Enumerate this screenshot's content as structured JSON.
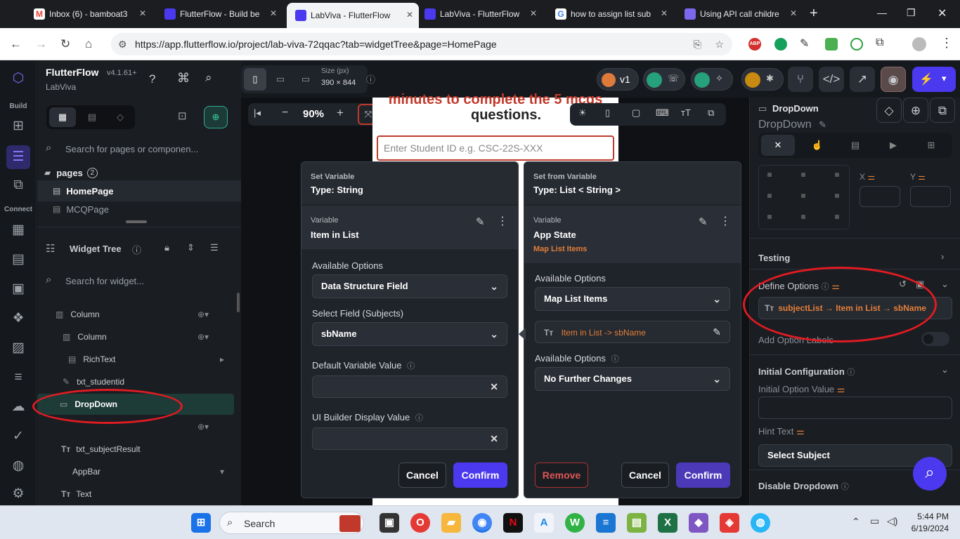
{
  "browser": {
    "tabs": [
      {
        "label": "Inbox (6) - bamboat3",
        "color": "#ea4335"
      },
      {
        "label": "FlutterFlow - Build be",
        "color": "#4b39ef"
      },
      {
        "label": "LabViva - FlutterFlow",
        "color": "#4b39ef"
      },
      {
        "label": "LabViva - FlutterFlow",
        "color": "#4b39ef"
      },
      {
        "label": "how to assign list sub",
        "color": "#4285f4"
      },
      {
        "label": "Using API call childre",
        "color": "#7b68ee"
      }
    ],
    "url": "https://app.flutterflow.io/project/lab-viva-72qqac?tab=widgetTree&page=HomePage"
  },
  "sidebar": {
    "brand": "FlutterFlow",
    "version": "v4.1.61+",
    "project": "LabViva",
    "build_label": "Build",
    "connect_label": "Connect",
    "search_pages_placeholder": "Search for pages or componen...",
    "pages_label": "pages",
    "pages_count": "2",
    "pages": [
      "HomePage",
      "MCQPage"
    ],
    "widget_tree_label": "Widget Tree",
    "search_widget_placeholder": "Search for widget...",
    "tree": [
      "Column",
      "Column",
      "RichText",
      "txt_studentid",
      "DropDown",
      "txt_subjectResult",
      "AppBar",
      "Text"
    ]
  },
  "toolbar": {
    "size_label": "Size (px)",
    "size_value": "390 × 844",
    "zoom": "90%",
    "version": "v1"
  },
  "canvas": {
    "preview_line1": "minutes to complete the 5 mcqs",
    "preview_line2": "questions.",
    "input_placeholder": "Enter Student ID e.g. CSC-22S-XXX"
  },
  "left_dialog": {
    "header_small": "Set Variable",
    "header_type": "Type: String",
    "var_small": "Variable",
    "var_name": "Item in List",
    "available_options_label": "Available Options",
    "available_options_value": "Data Structure Field",
    "select_field_label": "Select Field (Subjects)",
    "select_field_value": "sbName",
    "default_value_label": "Default Variable Value",
    "ui_builder_label": "UI Builder Display Value",
    "cancel": "Cancel",
    "confirm": "Confirm"
  },
  "right_dialog": {
    "header_small": "Set from Variable",
    "header_type": "Type: List < String >",
    "var_small": "Variable",
    "var_name": "App State",
    "var_sub": "Map List Items",
    "available_options_label": "Available Options",
    "available_options_value": "Map List Items",
    "chip_text": "Item in List -> sbName",
    "available_options2_label": "Available Options",
    "available_options2_value": "No Further Changes",
    "remove": "Remove",
    "cancel": "Cancel",
    "confirm": "Confirm"
  },
  "properties": {
    "widget_type": "DropDown",
    "widget_name": "DropDown",
    "x_label": "X",
    "y_label": "Y",
    "testing": "Testing",
    "define_options": "Define Options",
    "define_options_value": "subjectList → Item in List → sbName",
    "add_option_labels": "Add Option Labels",
    "initial_config": "Initial Configuration",
    "initial_option_value": "Initial Option Value",
    "hint_text": "Hint Text",
    "hint_value": "Select Subject",
    "disable_dropdown": "Disable Dropdown"
  },
  "taskbar": {
    "search": "Search",
    "time": "5:44 PM",
    "date": "6/19/2024"
  },
  "colors": {
    "accent": "#4b39ef",
    "orange": "#e37f3a",
    "annotation": "#e01b22"
  }
}
